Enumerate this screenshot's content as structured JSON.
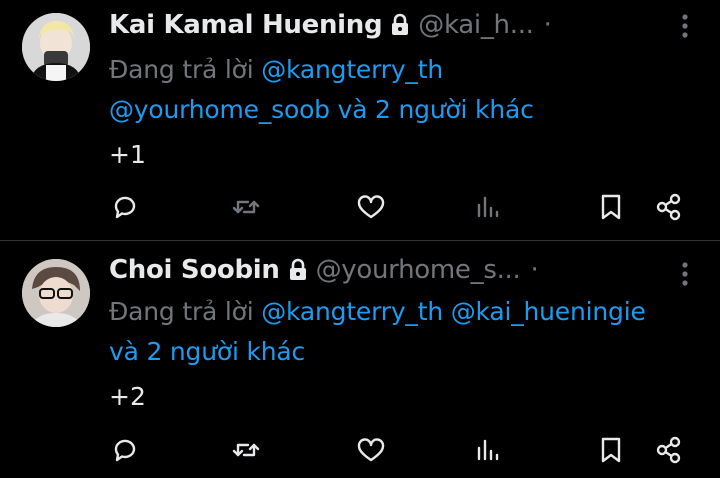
{
  "colors": {
    "background": "#000000",
    "primary_text": "#e7e9ea",
    "secondary_text": "#71767b",
    "link": "#1d9bf0",
    "divider": "#2f3336"
  },
  "tweets": [
    {
      "display_name": "Kai Kamal Huening",
      "handle": "@kai_h...",
      "separator": "·",
      "reply_prefix": "Đang trả lời",
      "mention_1": "@kangterry_th",
      "mention_2": "@yourhome_soob",
      "reply_suffix": "và 2 người khác",
      "text": "+1",
      "verified_icon": "lock-icon"
    },
    {
      "display_name": "Choi Soobin",
      "handle": "@yourhome_s...",
      "separator": "·",
      "reply_prefix": "Đang trả lời",
      "mention_1": "@kangterry_th",
      "mention_2": "@kai_hueningie",
      "reply_suffix": "và 2 người khác",
      "text": "+2",
      "verified_icon": "lock-icon"
    }
  ],
  "action_icons": [
    "reply-icon",
    "retweet-icon",
    "like-icon",
    "views-icon",
    "bookmark-icon",
    "share-icon"
  ]
}
